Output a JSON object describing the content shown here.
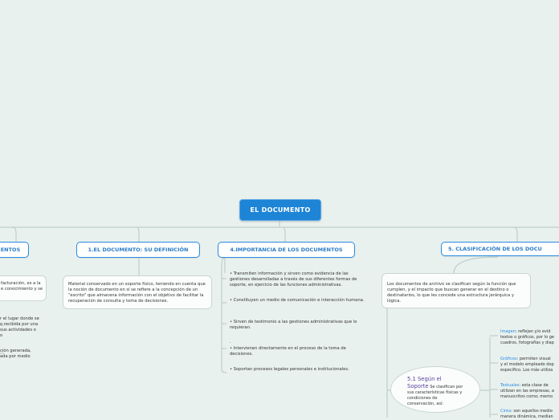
{
  "root": {
    "title": "EL DOCUMENTO"
  },
  "branches": {
    "left_partial": "ENTOS",
    "definicion": "1.EL DOCUMENTO: SU DEFINICIÓN",
    "importancia": "4.IMPORTANCIA DE LOS DOCUMENTOS",
    "clasificacion": "5.     CLASIFICACIÓN DE LOS DOCU"
  },
  "left_panel": {
    "lines": [
      "facturación, es a la",
      "e conocimiento y se"
    ],
    "frag1": [
      "r el lugar donde se",
      "o recibida por una",
      "sus actividades o",
      "o"
    ],
    "frag2": [
      "ción generada,",
      "ada por medio"
    ]
  },
  "definicion_text": "Material conservado en un soporte físico, teniendo en cuenta que la noción de documento en sí se refiere a la concepción de un \"escrito\" que almacena información con el objetivo de facilitar la recuperación de consulta y toma de decisiones.",
  "importancia_items": [
    "• Transmiten información y sirven como evidencia de las gestiones desarrolladas a través de sus diferentes formas de soporte, en ejercicio de las funciones administrativas.",
    "• Constituyen un medio de comunicación e interacción humana.",
    "• Sirven de testimonio a las gestiones administrativas que lo requieran.",
    ".",
    "• Intervienen directamente en el proceso de la toma de decisiones.",
    "• Soportan procesos legales personales e institucionales."
  ],
  "clasificacion_text": "Los documentos de archivo se clasifican según la función que cumplen, y el impacto que buscan generar en el destino o destinatarios, lo que les concede una estructura jerárquica y lógica.",
  "soporte": {
    "title": "5.1 Según el Soporte",
    "desc": "Se clasifican por sus características físicas y condiciones de conservación, así:"
  },
  "soporte_items": [
    {
      "term": "Imagen",
      "lines": [
        ": reflejan y/o evid",
        "textos o gráficos, por lo ge",
        "cuadros, fotografías y diap"
      ]
    },
    {
      "term": "Gráficos",
      "lines": [
        ": permiten visual",
        "y el modelo empleado dep",
        "específico. Los más utiliza"
      ]
    },
    {
      "term": "Textuales",
      "lines": [
        ": esta clase de",
        "utilizan en las empresas, a",
        "manuscritos como; memo"
      ]
    },
    {
      "term": "Cinta",
      "lines": [
        ": son aquellos medio",
        "manera dinámica, median"
      ]
    }
  ]
}
